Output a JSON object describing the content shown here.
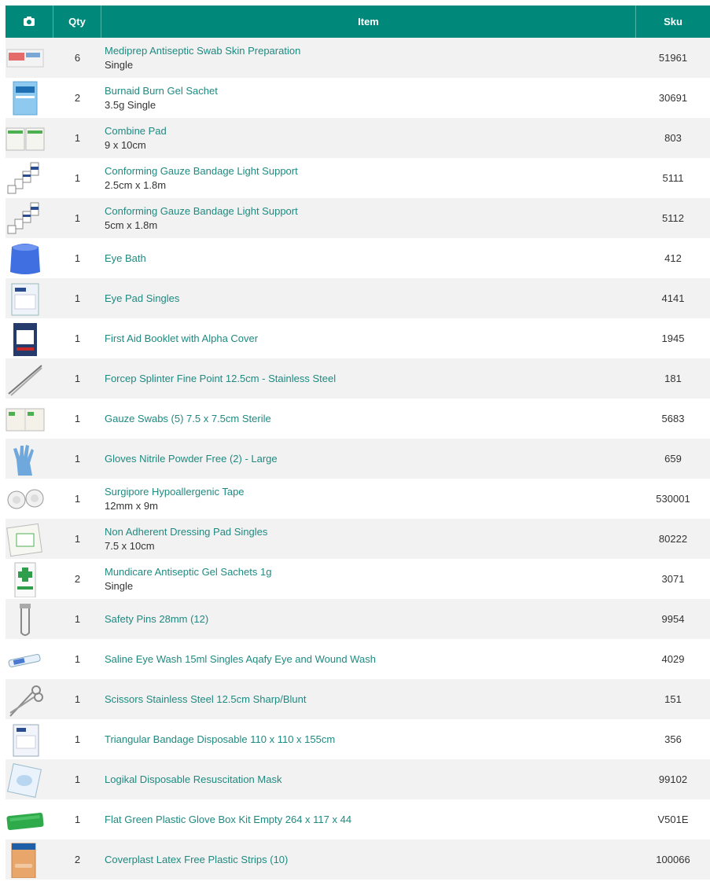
{
  "header": {
    "photo_icon": "camera-icon",
    "qty": "Qty",
    "item": "Item",
    "sku": "Sku"
  },
  "rows": [
    {
      "qty": "6",
      "name": "Mediprep Antiseptic Swab Skin Preparation",
      "sub": "Single",
      "sku": "51961",
      "thumb": "swab-box-image"
    },
    {
      "qty": "2",
      "name": "Burnaid Burn Gel Sachet",
      "sub": "3.5g Single",
      "sku": "30691",
      "thumb": "burn-gel-sachet-image"
    },
    {
      "qty": "1",
      "name": "Combine Pad",
      "sub": "9 x 10cm",
      "sku": "803",
      "thumb": "combine-pad-image"
    },
    {
      "qty": "1",
      "name": "Conforming Gauze Bandage Light Support",
      "sub": "2.5cm x 1.8m",
      "sku": "5111",
      "thumb": "gauze-bandage-image"
    },
    {
      "qty": "1",
      "name": "Conforming Gauze Bandage Light Support",
      "sub": "5cm x 1.8m",
      "sku": "5112",
      "thumb": "gauze-bandage-image"
    },
    {
      "qty": "1",
      "name": "Eye Bath",
      "sub": "",
      "sku": "412",
      "thumb": "eye-bath-image"
    },
    {
      "qty": "1",
      "name": "Eye Pad Singles",
      "sub": "",
      "sku": "4141",
      "thumb": "eye-pad-image"
    },
    {
      "qty": "1",
      "name": "First Aid Booklet with Alpha Cover",
      "sub": "",
      "sku": "1945",
      "thumb": "booklet-image"
    },
    {
      "qty": "1",
      "name": "Forcep Splinter Fine Point 12.5cm - Stainless Steel",
      "sub": "",
      "sku": "181",
      "thumb": "forcep-image"
    },
    {
      "qty": "1",
      "name": "Gauze Swabs (5) 7.5 x 7.5cm Sterile",
      "sub": "",
      "sku": "5683",
      "thumb": "gauze-swabs-image"
    },
    {
      "qty": "1",
      "name": "Gloves Nitrile Powder Free (2) - Large",
      "sub": "",
      "sku": "659",
      "thumb": "gloves-image"
    },
    {
      "qty": "1",
      "name": "Surgipore Hypoallergenic Tape",
      "sub": "12mm x 9m",
      "sku": "530001",
      "thumb": "tape-image"
    },
    {
      "qty": "1",
      "name": "Non Adherent Dressing Pad Singles",
      "sub": "7.5 x 10cm",
      "sku": "80222",
      "thumb": "dressing-pad-image"
    },
    {
      "qty": "2",
      "name": "Mundicare Antiseptic Gel Sachets 1g",
      "sub": "Single",
      "sku": "3071",
      "thumb": "gel-sachet-image"
    },
    {
      "qty": "1",
      "name": "Safety Pins 28mm (12)",
      "sub": "",
      "sku": "9954",
      "thumb": "safety-pin-image"
    },
    {
      "qty": "1",
      "name": "Saline Eye Wash 15ml Singles Aqafy Eye and Wound Wash",
      "sub": "",
      "sku": "4029",
      "thumb": "saline-vial-image"
    },
    {
      "qty": "1",
      "name": "Scissors Stainless Steel 12.5cm Sharp/Blunt",
      "sub": "",
      "sku": "151",
      "thumb": "scissors-image"
    },
    {
      "qty": "1",
      "name": "Triangular Bandage Disposable 110 x 110 x 155cm",
      "sub": "",
      "sku": "356",
      "thumb": "triangular-bandage-image"
    },
    {
      "qty": "1",
      "name": "Logikal Disposable Resuscitation Mask",
      "sub": "",
      "sku": "99102",
      "thumb": "resuscitation-mask-image"
    },
    {
      "qty": "1",
      "name": "Flat Green Plastic Glove Box Kit Empty 264 x 117 x 44",
      "sub": "",
      "sku": "V501E",
      "thumb": "green-box-image"
    },
    {
      "qty": "2",
      "name": "Coverplast Latex Free Plastic Strips (10)",
      "sub": "",
      "sku": "100066",
      "thumb": "plastic-strips-image"
    }
  ]
}
